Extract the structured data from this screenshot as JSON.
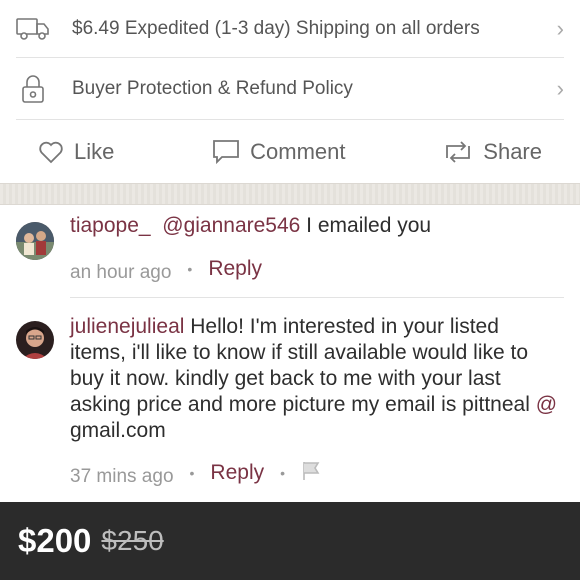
{
  "shipping": {
    "label": "$6.49 Expedited (1-3 day) Shipping on all orders",
    "icon": "truck-icon"
  },
  "protection": {
    "label": "Buyer Protection & Refund Policy",
    "icon": "lock-icon"
  },
  "actions": {
    "like_label": "Like",
    "comment_label": "Comment",
    "share_label": "Share"
  },
  "comments": [
    {
      "username": "tiapope_",
      "mention": "@giannare546",
      "text": " I emailed you",
      "time": "an hour ago",
      "reply_label": "Reply"
    },
    {
      "username": "julienejulieal",
      "text": "  Hello! I'm interested in your listed items, i'll like to know if still available would like to buy it now. kindly get back to me with your last asking price and more picture my email is pittneal ",
      "email_at": "@",
      "email_domain": "  gmail.com",
      "time": "37 mins ago",
      "reply_label": "Reply"
    }
  ],
  "footer": {
    "price": "$200",
    "original_price": "$250"
  },
  "colors": {
    "accent": "#7a3344",
    "footer_bg": "#2b2b2b"
  }
}
